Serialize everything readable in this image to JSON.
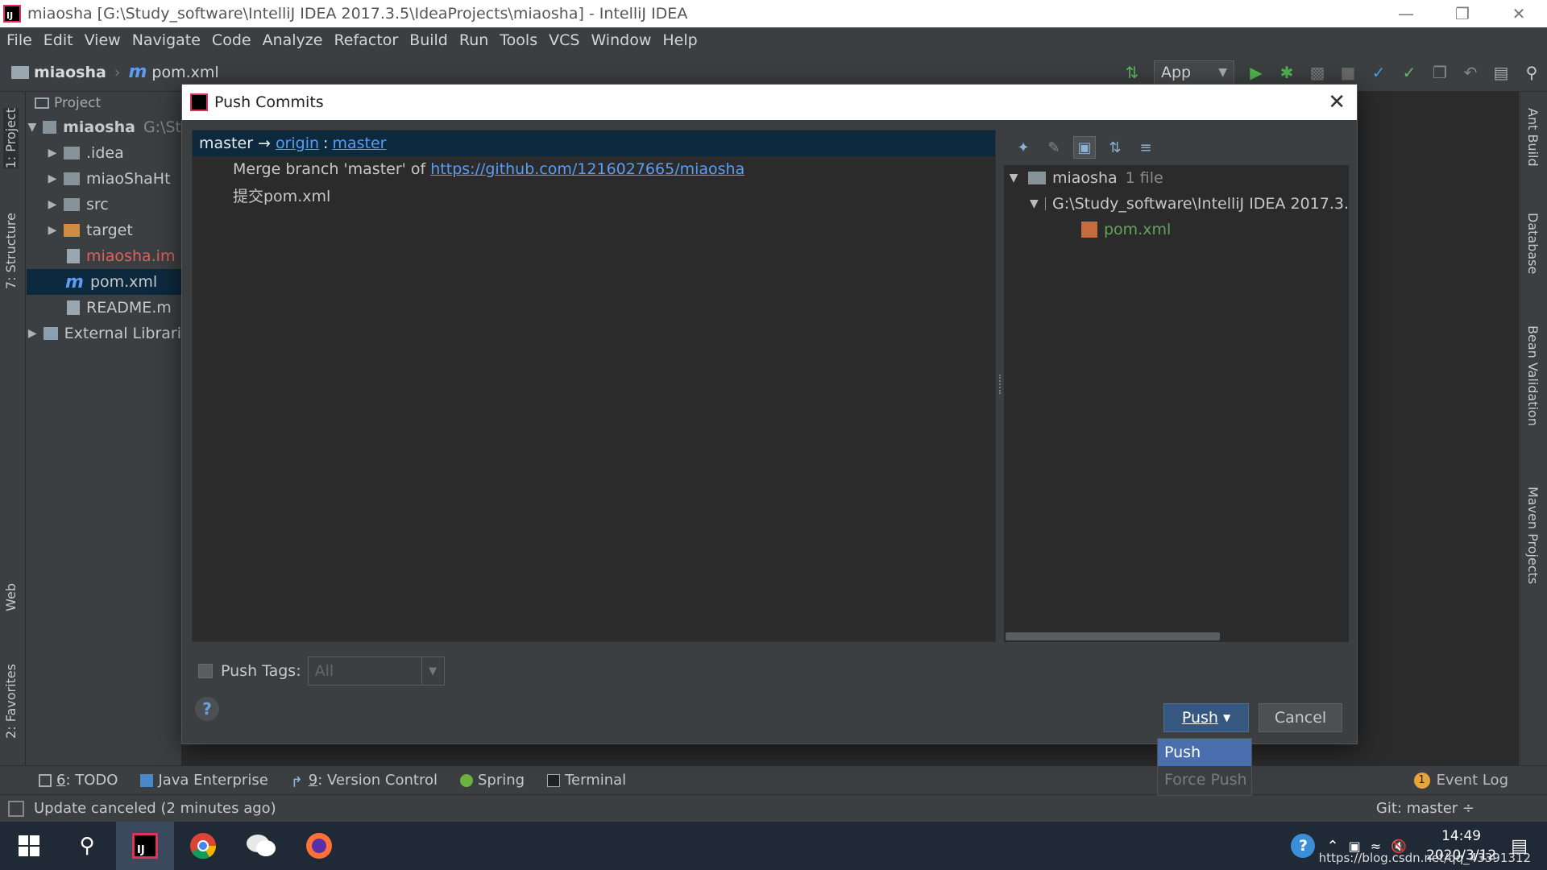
{
  "window": {
    "title": "miaosha [G:\\Study_software\\IntelliJ IDEA 2017.3.5\\IdeaProjects\\miaosha] - IntelliJ IDEA"
  },
  "menu": [
    "File",
    "Edit",
    "View",
    "Navigate",
    "Code",
    "Analyze",
    "Refactor",
    "Build",
    "Run",
    "Tools",
    "VCS",
    "Window",
    "Help"
  ],
  "navbar": {
    "project": "miaosha",
    "file": "pom.xml",
    "run_config": "App"
  },
  "left_tabs": {
    "project": "1: Project",
    "structure": "7: Structure",
    "web": "Web",
    "favorites": "2: Favorites"
  },
  "right_tabs": {
    "ant": "Ant Build",
    "database": "Database",
    "bean": "Bean Validation",
    "maven": "Maven Projects"
  },
  "project_panel": {
    "header": "Project",
    "root": "miaosha",
    "root_path": "G:\\St",
    "items": [
      ".idea",
      "miaoShaHt",
      "src",
      "target",
      "miaosha.im",
      "pom.xml",
      "README.m",
      "External Librari"
    ]
  },
  "dialog": {
    "title": "Push Commits",
    "branch": {
      "local": "master",
      "arrow": "→",
      "remote": "origin",
      "sep": ":",
      "remote_branch": "master"
    },
    "commits": [
      {
        "text": "Merge branch 'master' of",
        "link": "https://github.com/1216027665/miaosha"
      },
      {
        "text": "提交pom.xml"
      }
    ],
    "files": {
      "root": "miaosha",
      "root_count": "1 file",
      "folder": "G:\\Study_software\\IntelliJ IDEA 2017.3.",
      "file": "pom.xml"
    },
    "push_tags_label": "Push Tags:",
    "push_tags_value": "All",
    "help": "?",
    "push_button": "Push",
    "cancel_button": "Cancel"
  },
  "push_menu": {
    "push": "Push",
    "force_push": "Force Push"
  },
  "bottom_tabs": {
    "todo_num": "6",
    "todo": ": TODO",
    "java_ee": "Java Enterprise",
    "vc_num": "9",
    "vc": ": Version Control",
    "spring": "Spring",
    "terminal": "Terminal",
    "event_log": "Event Log",
    "event_count": "1"
  },
  "status": {
    "message": "Update canceled (2 minutes ago)",
    "git": "Git: master ÷"
  },
  "taskbar": {
    "time": "14:49",
    "date": "2020/3/12",
    "url": "https://blog.csdn.net/qq_43391312"
  },
  "colors": {
    "link": "#589df6",
    "selection": "#0d293e",
    "push_button": "#365880",
    "menu_selected": "#4b6eaf"
  }
}
